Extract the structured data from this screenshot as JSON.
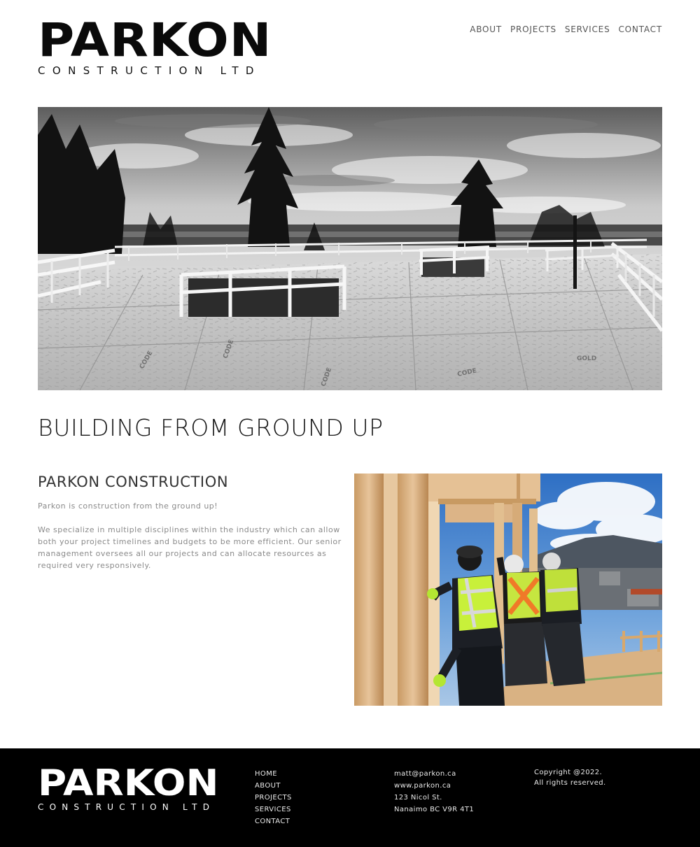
{
  "header": {
    "logo_word": "PARKON",
    "logo_sub": "CONSTRUCTION LTD",
    "nav": [
      {
        "label": "ABOUT"
      },
      {
        "label": "PROJECTS"
      },
      {
        "label": "SERVICES"
      },
      {
        "label": "CONTACT"
      }
    ]
  },
  "main": {
    "headline": "BUILDING FROM GROUND UP",
    "section_title": "PARKON CONSTRUCTION",
    "paragraphs": [
      "Parkon is construction from the ground up!",
      "We specialize in multiple disciplines within the industry which can allow both your project timelines and budgets to be more efficient. Our senior management oversees all our projects and can allocate resources as required very responsively."
    ]
  },
  "footer": {
    "logo_word": "PARKON",
    "logo_sub": "CONSTRUCTION LTD",
    "nav": [
      {
        "label": "HOME"
      },
      {
        "label": "ABOUT"
      },
      {
        "label": "PROJECTS"
      },
      {
        "label": "SERVICES"
      },
      {
        "label": "CONTACT"
      }
    ],
    "contact": {
      "email": "matt@parkon.ca",
      "website": "www.parkon.ca",
      "address_line1": "123 Nicol St.",
      "address_line2": "Nanaimo BC V9R 4T1"
    },
    "copyright_line1": "Copyright @2022.",
    "copyright_line2": "All rights reserved."
  }
}
